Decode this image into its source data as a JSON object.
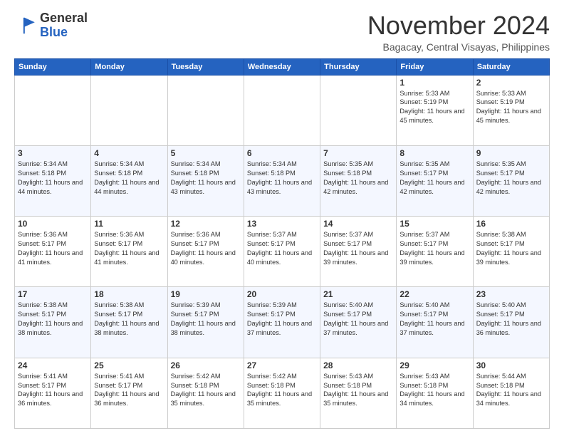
{
  "logo": {
    "general": "General",
    "blue": "Blue"
  },
  "header": {
    "month": "November 2024",
    "location": "Bagacay, Central Visayas, Philippines"
  },
  "weekdays": [
    "Sunday",
    "Monday",
    "Tuesday",
    "Wednesday",
    "Thursday",
    "Friday",
    "Saturday"
  ],
  "weeks": [
    [
      {
        "day": "",
        "sunrise": "",
        "sunset": "",
        "daylight": ""
      },
      {
        "day": "",
        "sunrise": "",
        "sunset": "",
        "daylight": ""
      },
      {
        "day": "",
        "sunrise": "",
        "sunset": "",
        "daylight": ""
      },
      {
        "day": "",
        "sunrise": "",
        "sunset": "",
        "daylight": ""
      },
      {
        "day": "",
        "sunrise": "",
        "sunset": "",
        "daylight": ""
      },
      {
        "day": "1",
        "sunrise": "Sunrise: 5:33 AM",
        "sunset": "Sunset: 5:19 PM",
        "daylight": "Daylight: 11 hours and 45 minutes."
      },
      {
        "day": "2",
        "sunrise": "Sunrise: 5:33 AM",
        "sunset": "Sunset: 5:19 PM",
        "daylight": "Daylight: 11 hours and 45 minutes."
      }
    ],
    [
      {
        "day": "3",
        "sunrise": "Sunrise: 5:34 AM",
        "sunset": "Sunset: 5:18 PM",
        "daylight": "Daylight: 11 hours and 44 minutes."
      },
      {
        "day": "4",
        "sunrise": "Sunrise: 5:34 AM",
        "sunset": "Sunset: 5:18 PM",
        "daylight": "Daylight: 11 hours and 44 minutes."
      },
      {
        "day": "5",
        "sunrise": "Sunrise: 5:34 AM",
        "sunset": "Sunset: 5:18 PM",
        "daylight": "Daylight: 11 hours and 43 minutes."
      },
      {
        "day": "6",
        "sunrise": "Sunrise: 5:34 AM",
        "sunset": "Sunset: 5:18 PM",
        "daylight": "Daylight: 11 hours and 43 minutes."
      },
      {
        "day": "7",
        "sunrise": "Sunrise: 5:35 AM",
        "sunset": "Sunset: 5:18 PM",
        "daylight": "Daylight: 11 hours and 42 minutes."
      },
      {
        "day": "8",
        "sunrise": "Sunrise: 5:35 AM",
        "sunset": "Sunset: 5:17 PM",
        "daylight": "Daylight: 11 hours and 42 minutes."
      },
      {
        "day": "9",
        "sunrise": "Sunrise: 5:35 AM",
        "sunset": "Sunset: 5:17 PM",
        "daylight": "Daylight: 11 hours and 42 minutes."
      }
    ],
    [
      {
        "day": "10",
        "sunrise": "Sunrise: 5:36 AM",
        "sunset": "Sunset: 5:17 PM",
        "daylight": "Daylight: 11 hours and 41 minutes."
      },
      {
        "day": "11",
        "sunrise": "Sunrise: 5:36 AM",
        "sunset": "Sunset: 5:17 PM",
        "daylight": "Daylight: 11 hours and 41 minutes."
      },
      {
        "day": "12",
        "sunrise": "Sunrise: 5:36 AM",
        "sunset": "Sunset: 5:17 PM",
        "daylight": "Daylight: 11 hours and 40 minutes."
      },
      {
        "day": "13",
        "sunrise": "Sunrise: 5:37 AM",
        "sunset": "Sunset: 5:17 PM",
        "daylight": "Daylight: 11 hours and 40 minutes."
      },
      {
        "day": "14",
        "sunrise": "Sunrise: 5:37 AM",
        "sunset": "Sunset: 5:17 PM",
        "daylight": "Daylight: 11 hours and 39 minutes."
      },
      {
        "day": "15",
        "sunrise": "Sunrise: 5:37 AM",
        "sunset": "Sunset: 5:17 PM",
        "daylight": "Daylight: 11 hours and 39 minutes."
      },
      {
        "day": "16",
        "sunrise": "Sunrise: 5:38 AM",
        "sunset": "Sunset: 5:17 PM",
        "daylight": "Daylight: 11 hours and 39 minutes."
      }
    ],
    [
      {
        "day": "17",
        "sunrise": "Sunrise: 5:38 AM",
        "sunset": "Sunset: 5:17 PM",
        "daylight": "Daylight: 11 hours and 38 minutes."
      },
      {
        "day": "18",
        "sunrise": "Sunrise: 5:38 AM",
        "sunset": "Sunset: 5:17 PM",
        "daylight": "Daylight: 11 hours and 38 minutes."
      },
      {
        "day": "19",
        "sunrise": "Sunrise: 5:39 AM",
        "sunset": "Sunset: 5:17 PM",
        "daylight": "Daylight: 11 hours and 38 minutes."
      },
      {
        "day": "20",
        "sunrise": "Sunrise: 5:39 AM",
        "sunset": "Sunset: 5:17 PM",
        "daylight": "Daylight: 11 hours and 37 minutes."
      },
      {
        "day": "21",
        "sunrise": "Sunrise: 5:40 AM",
        "sunset": "Sunset: 5:17 PM",
        "daylight": "Daylight: 11 hours and 37 minutes."
      },
      {
        "day": "22",
        "sunrise": "Sunrise: 5:40 AM",
        "sunset": "Sunset: 5:17 PM",
        "daylight": "Daylight: 11 hours and 37 minutes."
      },
      {
        "day": "23",
        "sunrise": "Sunrise: 5:40 AM",
        "sunset": "Sunset: 5:17 PM",
        "daylight": "Daylight: 11 hours and 36 minutes."
      }
    ],
    [
      {
        "day": "24",
        "sunrise": "Sunrise: 5:41 AM",
        "sunset": "Sunset: 5:17 PM",
        "daylight": "Daylight: 11 hours and 36 minutes."
      },
      {
        "day": "25",
        "sunrise": "Sunrise: 5:41 AM",
        "sunset": "Sunset: 5:17 PM",
        "daylight": "Daylight: 11 hours and 36 minutes."
      },
      {
        "day": "26",
        "sunrise": "Sunrise: 5:42 AM",
        "sunset": "Sunset: 5:18 PM",
        "daylight": "Daylight: 11 hours and 35 minutes."
      },
      {
        "day": "27",
        "sunrise": "Sunrise: 5:42 AM",
        "sunset": "Sunset: 5:18 PM",
        "daylight": "Daylight: 11 hours and 35 minutes."
      },
      {
        "day": "28",
        "sunrise": "Sunrise: 5:43 AM",
        "sunset": "Sunset: 5:18 PM",
        "daylight": "Daylight: 11 hours and 35 minutes."
      },
      {
        "day": "29",
        "sunrise": "Sunrise: 5:43 AM",
        "sunset": "Sunset: 5:18 PM",
        "daylight": "Daylight: 11 hours and 34 minutes."
      },
      {
        "day": "30",
        "sunrise": "Sunrise: 5:44 AM",
        "sunset": "Sunset: 5:18 PM",
        "daylight": "Daylight: 11 hours and 34 minutes."
      }
    ]
  ]
}
